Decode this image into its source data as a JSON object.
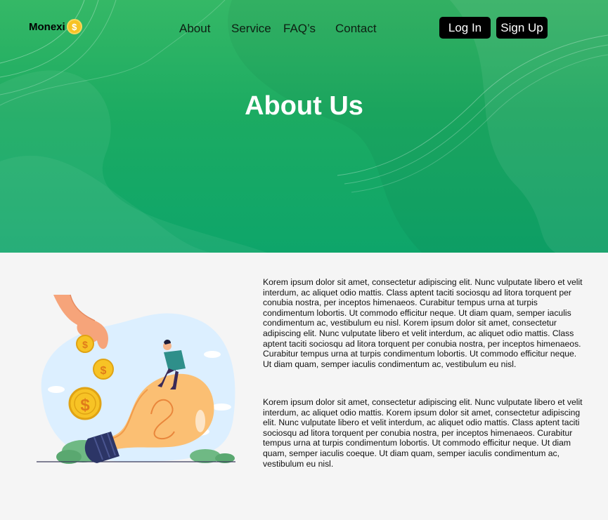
{
  "brand": {
    "name": "Monexi",
    "coin_symbol": "$"
  },
  "nav": {
    "about": "About",
    "service": "Service",
    "faqs": "FAQ’s",
    "contact": "Contact"
  },
  "auth": {
    "login": "Log In",
    "signup": "Sign Up"
  },
  "hero": {
    "title": "About Us"
  },
  "content": {
    "paragraph_1": "Korem ipsum dolor sit amet, consectetur adipiscing elit. Nunc vulputate libero et velit interdum, ac aliquet odio mattis. Class aptent taciti sociosqu ad litora torquent per conubia nostra, per inceptos himenaeos. Curabitur tempus urna at turpis condimentum lobortis. Ut commodo efficitur neque. Ut diam quam, semper iaculis condimentum ac, vestibulum eu nisl.  Korem ipsum dolor sit amet, consectetur adipiscing elit. Nunc vulputate libero et velit interdum, ac aliquet odio mattis. Class aptent taciti sociosqu ad litora torquent per conubia nostra, per inceptos himenaeos. Curabitur tempus urna at turpis condimentum lobortis. Ut commodo efficitur neque. Ut diam quam, semper iaculis condimentum ac, vestibulum eu nisl.",
    "paragraph_2": "Korem ipsum dolor sit amet, consectetur adipiscing elit. Nunc vulputate libero et velit interdum, ac aliquet odio mattis.  Korem ipsum dolor sit amet, consectetur adipiscing elit. Nunc vulputate libero et velit interdum, ac aliquet odio mattis. Class aptent taciti sociosqu ad litora torquent per conubia nostra, per inceptos himenaeos. Curabitur tempus urna at turpis condimentum lobortis. Ut commodo efficitur neque. Ut diam quam, semper iaculis coeque. Ut diam quam, semper iaculis condimentum ac, vestibulum eu nisl."
  },
  "colors": {
    "hero_green": "#1cab62",
    "button_black": "#000000",
    "coin_gold": "#f7c325",
    "bulb_orange": "#fbbf73"
  },
  "icons": {
    "logo_coin": "dollar-coin-icon",
    "illustration": "lightbulb-money-illustration"
  }
}
